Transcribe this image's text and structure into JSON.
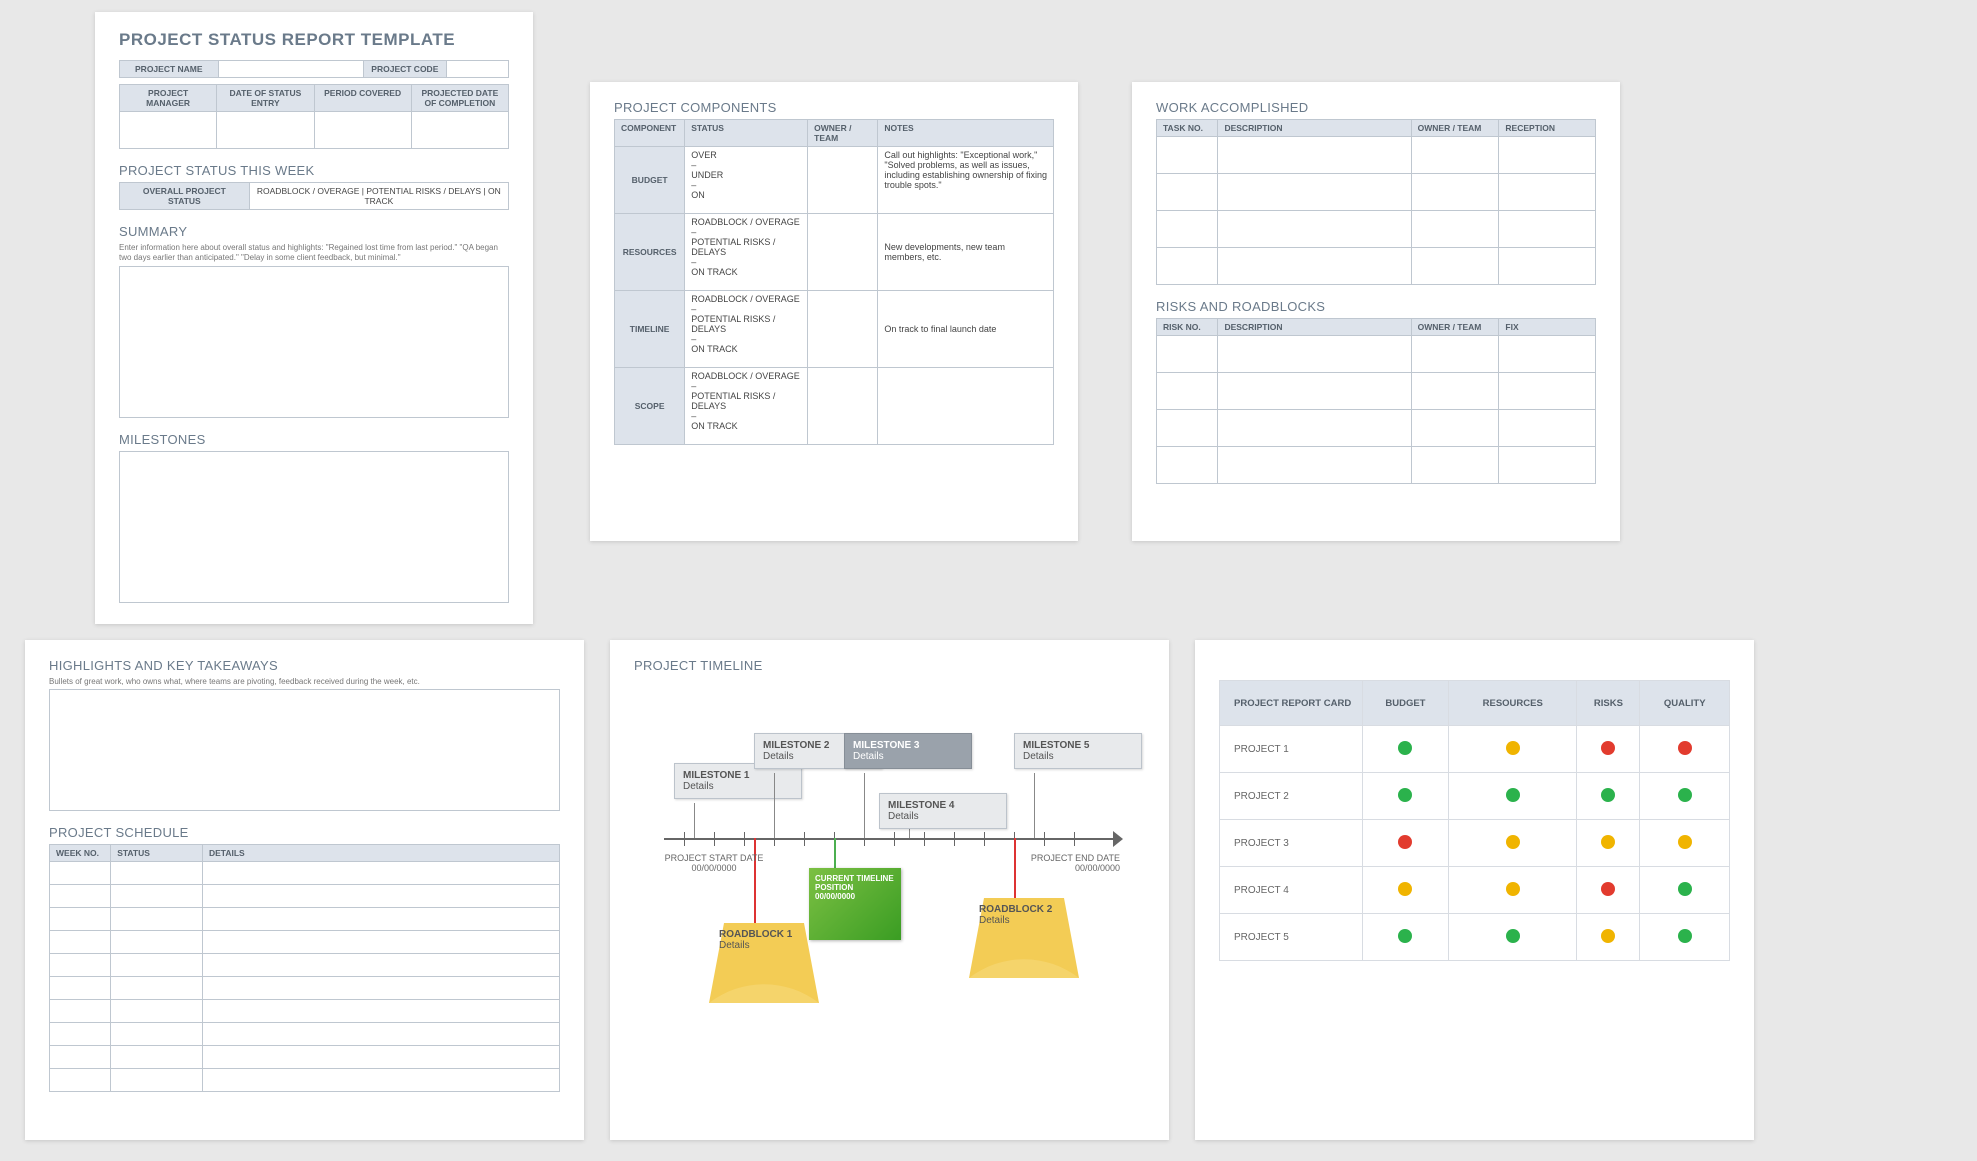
{
  "page1": {
    "title": "PROJECT STATUS REPORT TEMPLATE",
    "row1": {
      "projectName": "PROJECT NAME",
      "projectCode": "PROJECT CODE"
    },
    "row2": [
      "PROJECT MANAGER",
      "DATE OF STATUS ENTRY",
      "PERIOD COVERED",
      "PROJECTED DATE OF COMPLETION"
    ],
    "statusWeek": "PROJECT STATUS THIS WEEK",
    "statusRow": {
      "label": "OVERALL PROJECT STATUS",
      "opts": "ROADBLOCK / OVERAGE   |   POTENTIAL RISKS / DELAYS   |   ON TRACK"
    },
    "summary": "SUMMARY",
    "summaryNote": "Enter information here about overall status and highlights: \"Regained lost time from last period.\" \"QA began two days earlier than anticipated.\" \"Delay in some client feedback, but minimal.\"",
    "milestones": "MILESTONES"
  },
  "page2": {
    "title": "PROJECT COMPONENTS",
    "headers": [
      "COMPONENT",
      "STATUS",
      "OWNER / TEAM",
      "NOTES"
    ],
    "rows": [
      {
        "c": "BUDGET",
        "s": "OVER\n–\nUNDER\n–\nON",
        "n": "Call out highlights: \"Exceptional work,\" \"Solved problems, as well as issues, including establishing ownership of fixing trouble spots.\""
      },
      {
        "c": "RESOURCES",
        "s": "ROADBLOCK / OVERAGE\n–\nPOTENTIAL RISKS / DELAYS\n–\nON TRACK",
        "n": "New developments, new team members, etc."
      },
      {
        "c": "TIMELINE",
        "s": "ROADBLOCK / OVERAGE\n–\nPOTENTIAL RISKS / DELAYS\n–\nON TRACK",
        "n": "On track to final launch date"
      },
      {
        "c": "SCOPE",
        "s": "ROADBLOCK / OVERAGE\n–\nPOTENTIAL RISKS / DELAYS\n–\nON TRACK",
        "n": ""
      }
    ]
  },
  "page3": {
    "work": {
      "title": "WORK ACCOMPLISHED",
      "headers": [
        "TASK NO.",
        "DESCRIPTION",
        "OWNER / TEAM",
        "RECEPTION"
      ]
    },
    "risks": {
      "title": "RISKS AND ROADBLOCKS",
      "headers": [
        "RISK NO.",
        "DESCRIPTION",
        "OWNER / TEAM",
        "FIX"
      ]
    }
  },
  "page4": {
    "highlights": "HIGHLIGHTS AND KEY TAKEAWAYS",
    "highlightsNote": "Bullets of great work, who owns what, where teams are pivoting, feedback received during the week, etc.",
    "schedule": "PROJECT SCHEDULE",
    "scheduleHeaders": [
      "WEEK NO.",
      "STATUS",
      "DETAILS"
    ]
  },
  "page5": {
    "title": "PROJECT TIMELINE",
    "milestones": [
      {
        "n": "MILESTONE 1",
        "d": "Details"
      },
      {
        "n": "MILESTONE 2",
        "d": "Details"
      },
      {
        "n": "MILESTONE 3",
        "d": "Details"
      },
      {
        "n": "MILESTONE 4",
        "d": "Details"
      },
      {
        "n": "MILESTONE 5",
        "d": "Details"
      }
    ],
    "current": "CURRENT TIMELINE POSITION 00/00/0000",
    "roadblocks": [
      {
        "n": "ROADBLOCK 1",
        "d": "Details"
      },
      {
        "n": "ROADBLOCK 2",
        "d": "Details"
      }
    ],
    "start": {
      "l": "PROJECT START DATE",
      "d": "00/00/0000"
    },
    "end": {
      "l": "PROJECT END DATE",
      "d": "00/00/0000"
    }
  },
  "page6": {
    "headers": [
      "PROJECT REPORT CARD",
      "BUDGET",
      "RESOURCES",
      "RISKS",
      "QUALITY"
    ],
    "rows": [
      {
        "name": "PROJECT 1",
        "cells": [
          "g",
          "y",
          "r",
          "r"
        ]
      },
      {
        "name": "PROJECT 2",
        "cells": [
          "g",
          "g",
          "g",
          "g"
        ]
      },
      {
        "name": "PROJECT 3",
        "cells": [
          "r",
          "y",
          "y",
          "y"
        ]
      },
      {
        "name": "PROJECT 4",
        "cells": [
          "y",
          "y",
          "r",
          "g"
        ]
      },
      {
        "name": "PROJECT 5",
        "cells": [
          "g",
          "g",
          "y",
          "g"
        ]
      }
    ]
  }
}
